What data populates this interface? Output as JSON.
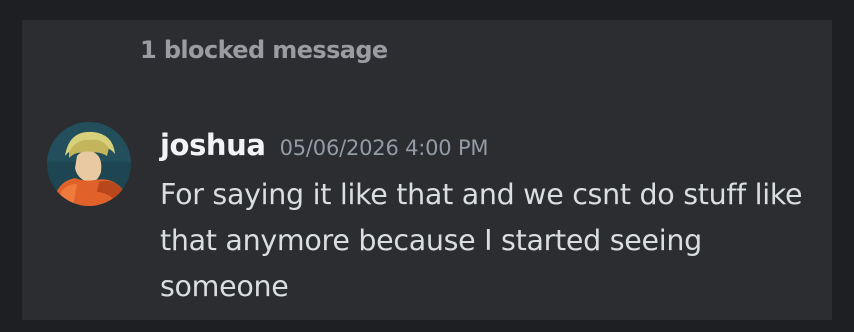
{
  "blocked": {
    "label": "1 blocked message"
  },
  "message": {
    "username": "joshua",
    "timestamp": "05/06/2026 4:00 PM",
    "lines": [
      "For saying it like that and we csnt do stuff like",
      "that anymore because I started seeing",
      "someone"
    ]
  },
  "colors": {
    "background": "#1e1f22",
    "panel": "#2b2d31",
    "username": "#f2f3f5",
    "timestamp": "#949ba4",
    "text": "#dbdee1",
    "blocked": "#9a9ca2"
  }
}
